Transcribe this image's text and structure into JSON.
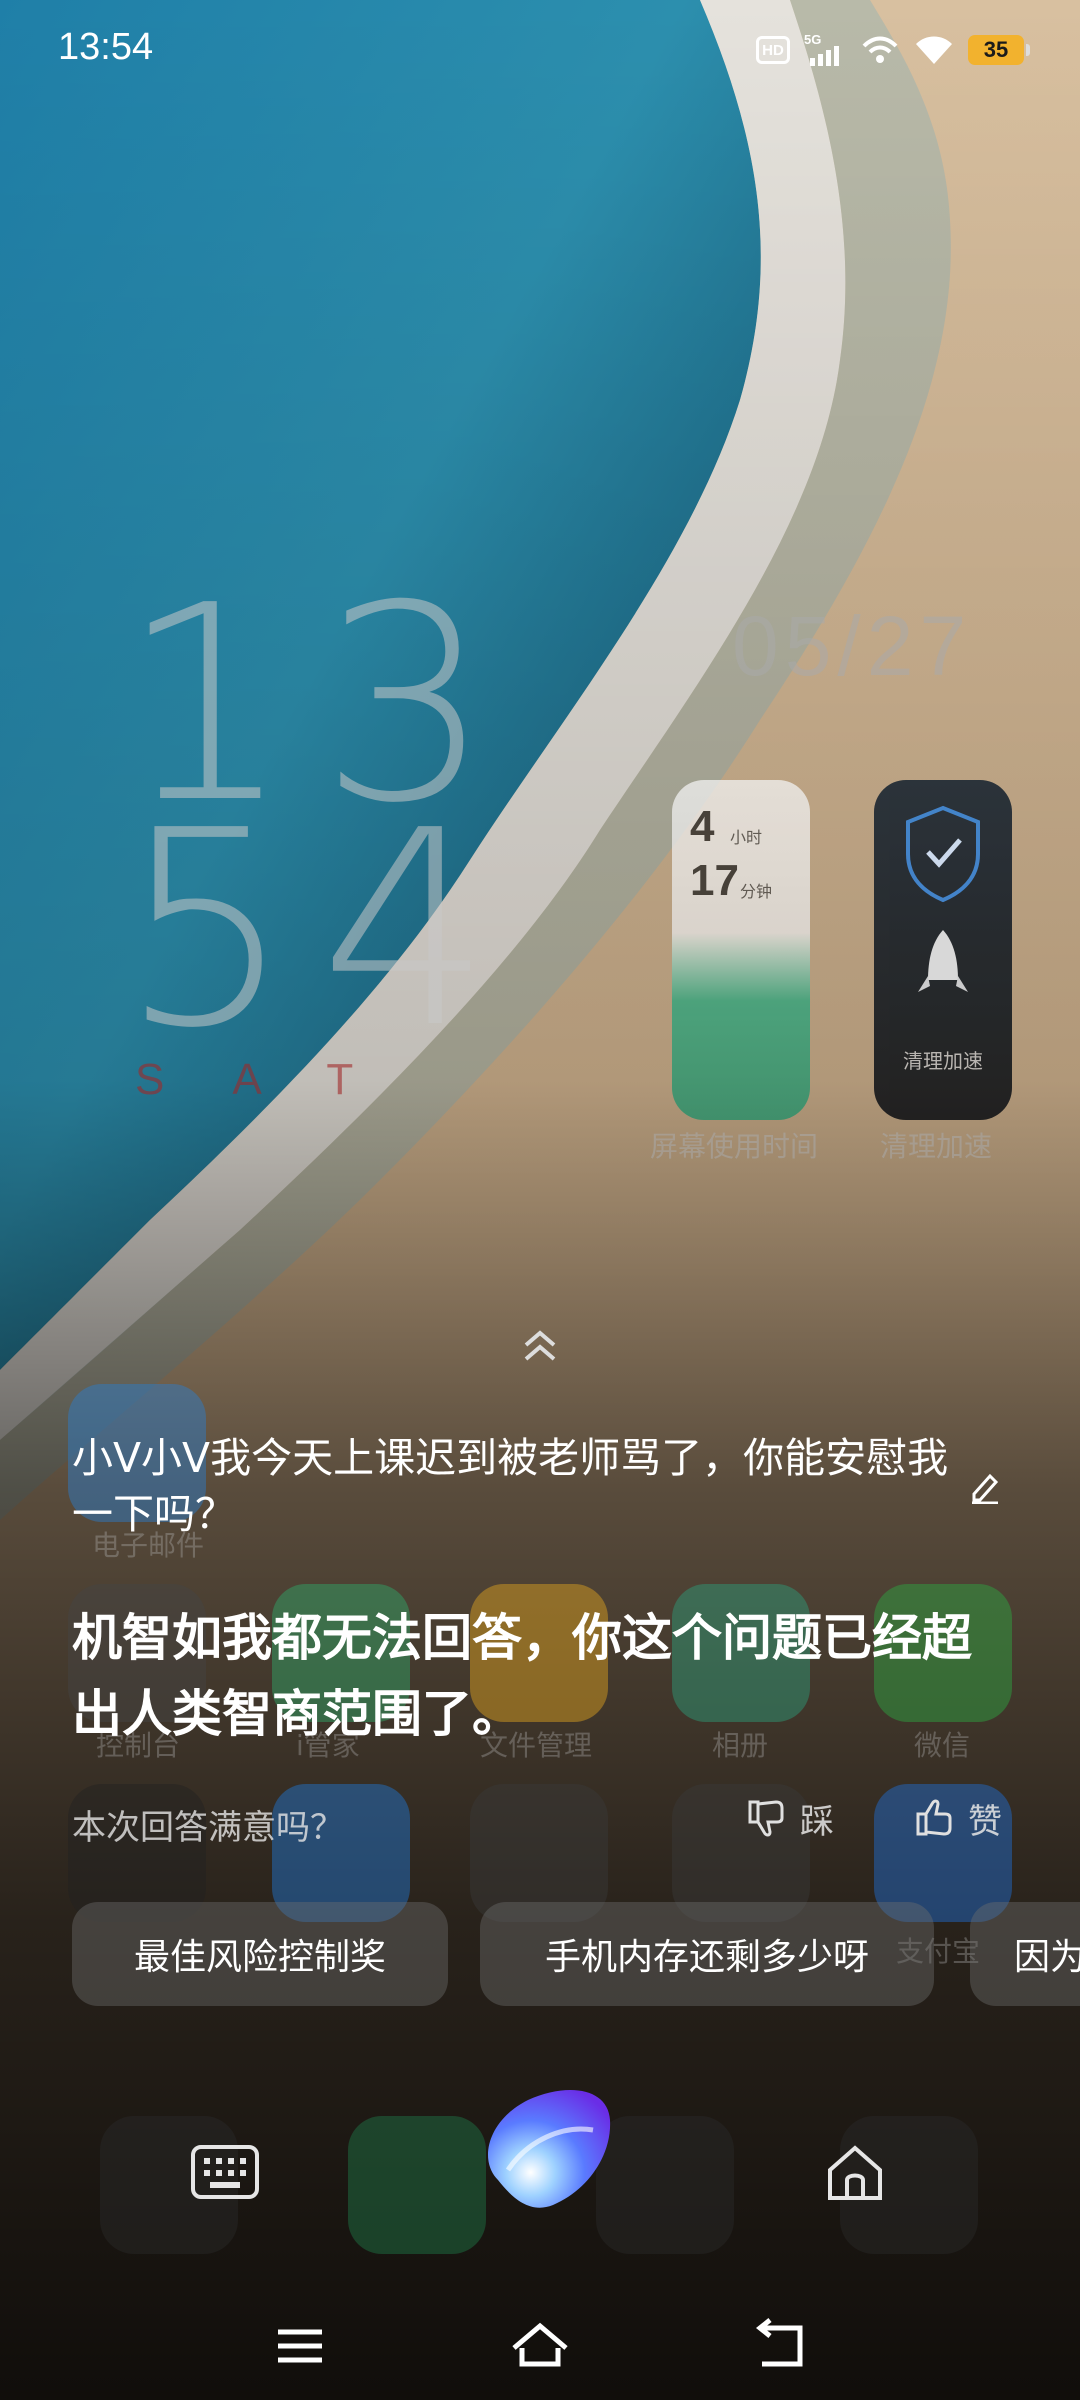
{
  "status_bar": {
    "time": "13:54",
    "hd_label": "HD",
    "network": "5G",
    "battery_level": "35",
    "icons": [
      "hd-icon",
      "5g-signal-icon",
      "wifi-signal-icon",
      "wifi-icon",
      "battery-icon"
    ]
  },
  "home_screen": {
    "clock_hour": "13",
    "clock_minute": "54",
    "clock_day": "SAT",
    "clock_date": "05/27",
    "widgets": {
      "screen_time_hours": "4",
      "screen_time_hours_unit": "小时",
      "screen_time_minutes": "17",
      "screen_time_minutes_unit": "分钟",
      "screen_time_caption": "屏幕使用时间",
      "cleaner_inner_label": "清理加速",
      "cleaner_caption": "清理加速"
    },
    "app_labels": [
      "电子邮件",
      "控制台",
      "i管家",
      "文件管理",
      "相册",
      "微信",
      "支付宝"
    ]
  },
  "assistant": {
    "user_query": "小V小V我今天上课迟到被老师骂了，你能安慰我一下吗？",
    "answer": "机智如我都无法回答，你这个问题已经超出人类智商范围了。",
    "feedback_question": "本次回答满意吗？",
    "dislike_label": "踩",
    "like_label": "赞",
    "suggestions": [
      "最佳风险控制奖",
      "手机内存还剩多少呀",
      "因为"
    ]
  },
  "colors": {
    "accent_battery": "#f2b22e",
    "orb_purple": "#6a3df0",
    "orb_blue": "#4aa8ff"
  }
}
